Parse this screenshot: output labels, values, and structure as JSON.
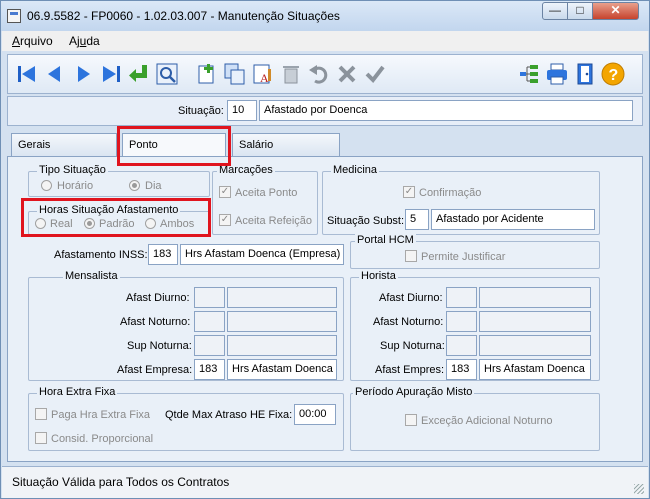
{
  "window": {
    "title": "06.9.5582 - FP0060 - 1.02.03.007 - Manutenção Situações"
  },
  "menu": {
    "arquivo_pre": "A",
    "arquivo_rest": "rquivo",
    "ajuda_pre": "Aj",
    "ajuda_u": "u",
    "ajuda_rest": "da"
  },
  "toolbar_icons": [
    "first-icon",
    "prev-icon",
    "next-icon",
    "last-icon",
    "enter-icon",
    "zoom-icon",
    "new-icon",
    "copy-icon",
    "edit-icon",
    "delete-icon",
    "undo-icon",
    "cancel-icon",
    "confirm-icon",
    "tree-icon",
    "print-icon",
    "exit-icon",
    "help-icon"
  ],
  "situacao": {
    "label": "Situação:",
    "code": "10",
    "description": "Afastado por Doenca"
  },
  "tabs": [
    {
      "label": "Gerais"
    },
    {
      "label": "Ponto"
    },
    {
      "label": "Salário"
    }
  ],
  "tipo_situacao": {
    "title": "Tipo Situação",
    "horario": "Horário",
    "dia": "Dia",
    "selected": "Dia"
  },
  "horas_afast": {
    "title": "Horas Situação Afastamento",
    "real": "Real",
    "padrao": "Padrão",
    "ambos": "Ambos",
    "selected": "Padrão"
  },
  "marcacoes": {
    "title": "Marcações",
    "aceita_ponto": "Aceita Ponto",
    "aceita_refeicao": "Aceita Refeição"
  },
  "medicina": {
    "title": "Medicina",
    "confirmacao": "Confirmação",
    "sit_subst_label": "Situação Subst:",
    "sit_subst_code": "5",
    "sit_subst_desc": "Afastado por Acidente"
  },
  "afastamento_inss": {
    "label": "Afastamento INSS:",
    "code": "183",
    "desc": "Hrs Afastam Doenca   (Empresa)"
  },
  "portal_hcm": {
    "title": "Portal HCM",
    "permite": "Permite Justificar"
  },
  "mensalista": {
    "title": "Mensalista",
    "diurno": "Afast Diurno:",
    "noturno": "Afast Noturno:",
    "sup_noturna": "Sup Noturna:",
    "empresa": "Afast Empresa:",
    "empresa_code": "183",
    "empresa_desc": "Hrs Afastam Doenca"
  },
  "horista": {
    "title": "Horista",
    "diurno": "Afast Diurno:",
    "noturno": "Afast Noturno:",
    "sup_noturna": "Sup Noturna:",
    "empresa": "Afast Empres:",
    "empresa_code": "183",
    "empresa_desc": "Hrs Afastam Doenca"
  },
  "hora_extra": {
    "title": "Hora Extra Fixa",
    "paga": "Paga Hra Extra Fixa",
    "consid": "Consid. Proporcional",
    "qtde_label": "Qtde Max Atraso HE Fixa:",
    "qtde_value": "00:00"
  },
  "periodo": {
    "title": "Período Apuração Misto",
    "excecao": "Exceção Adicional Noturno"
  },
  "status": {
    "text": "Situação Válida para Todos os Contratos"
  }
}
